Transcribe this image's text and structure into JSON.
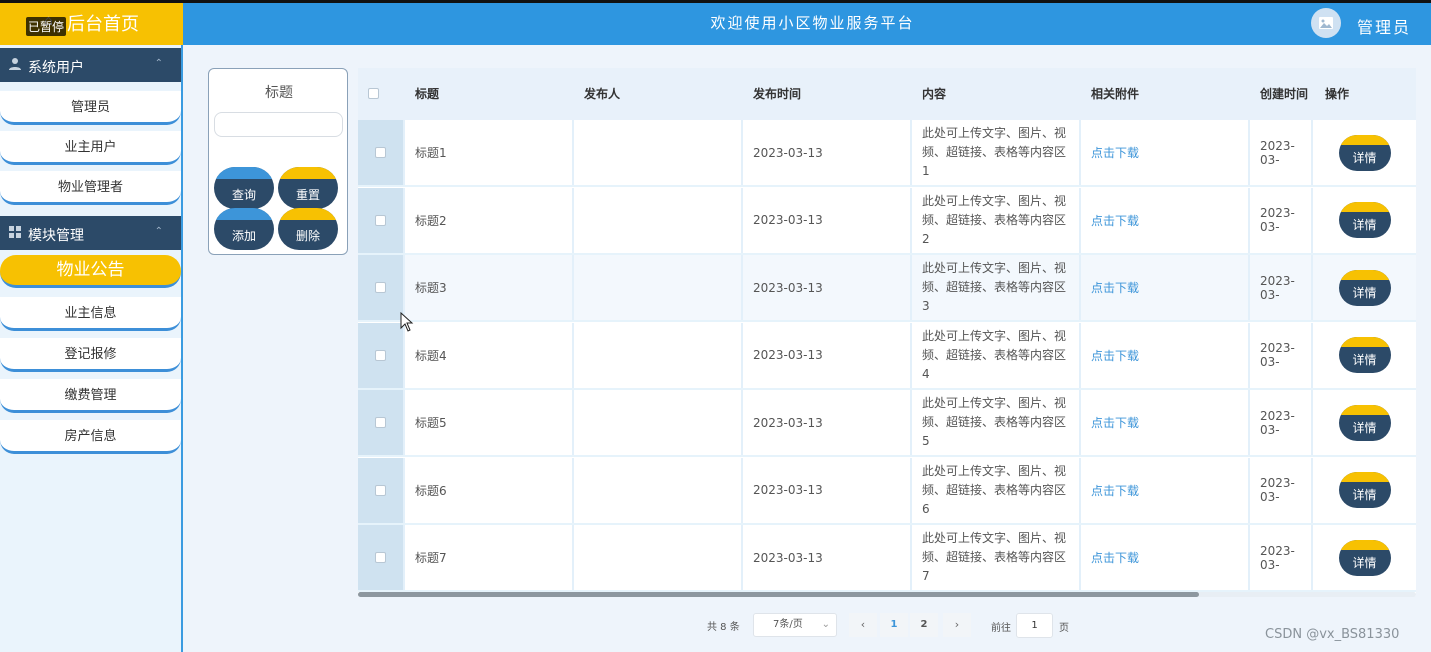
{
  "header": {
    "home_title": "后台首页",
    "paused_badge": "已暂停",
    "platform_title": "欢迎使用小区物业服务平台",
    "admin_name": "管理员",
    "header_color": "#2e96e0",
    "home_color": "#f7c102"
  },
  "sidebar": {
    "group_system": "系统用户",
    "system_items": [
      "管理员",
      "业主用户",
      "物业管理者"
    ],
    "group_module": "模块管理",
    "module_items": [
      "物业公告",
      "业主信息",
      "登记报修",
      "缴费管理",
      "房产信息"
    ],
    "active_item": "物业公告"
  },
  "search": {
    "label": "标题",
    "placeholder": "",
    "buttons": {
      "query": "查询",
      "reset": "重置",
      "add": "添加",
      "delete": "删除"
    }
  },
  "table": {
    "columns": [
      "标题",
      "发布人",
      "发布时间",
      "内容",
      "相关附件",
      "创建时间",
      "操作"
    ],
    "rows": [
      {
        "title": "标题1",
        "publisher": "",
        "publish_time": "2023-03-13",
        "content": "此处可上传文字、图片、视频、超链接、表格等内容区1",
        "attachment": "点击下载",
        "created": "2023-03-",
        "action": "详情"
      },
      {
        "title": "标题2",
        "publisher": "",
        "publish_time": "2023-03-13",
        "content": "此处可上传文字、图片、视频、超链接、表格等内容区2",
        "attachment": "点击下载",
        "created": "2023-03-",
        "action": "详情"
      },
      {
        "title": "标题3",
        "publisher": "",
        "publish_time": "2023-03-13",
        "content": "此处可上传文字、图片、视频、超链接、表格等内容区3",
        "attachment": "点击下载",
        "created": "2023-03-",
        "action": "详情"
      },
      {
        "title": "标题4",
        "publisher": "",
        "publish_time": "2023-03-13",
        "content": "此处可上传文字、图片、视频、超链接、表格等内容区4",
        "attachment": "点击下载",
        "created": "2023-03-",
        "action": "详情"
      },
      {
        "title": "标题5",
        "publisher": "",
        "publish_time": "2023-03-13",
        "content": "此处可上传文字、图片、视频、超链接、表格等内容区5",
        "attachment": "点击下载",
        "created": "2023-03-",
        "action": "详情"
      },
      {
        "title": "标题6",
        "publisher": "",
        "publish_time": "2023-03-13",
        "content": "此处可上传文字、图片、视频、超链接、表格等内容区6",
        "attachment": "点击下载",
        "created": "2023-03-",
        "action": "详情"
      },
      {
        "title": "标题7",
        "publisher": "",
        "publish_time": "2023-03-13",
        "content": "此处可上传文字、图片、视频、超链接、表格等内容区7",
        "attachment": "点击下载",
        "created": "2023-03-",
        "action": "详情"
      }
    ]
  },
  "pagination": {
    "total": "共 8 条",
    "page_size": "7条/页",
    "pages": [
      "1",
      "2"
    ],
    "current_page": "1",
    "goto_label": "前往",
    "goto_value": "1",
    "page_suffix": "页"
  },
  "watermark": "CSDN @vx_BS81330"
}
